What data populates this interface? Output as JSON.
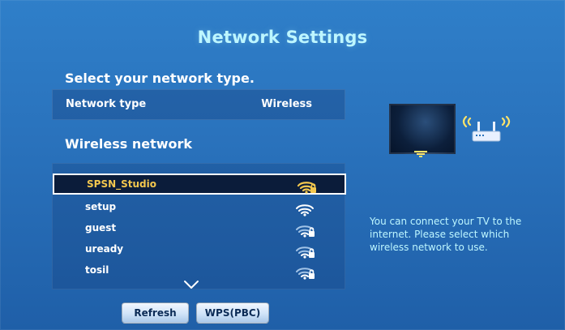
{
  "header": {
    "title": "Network Settings"
  },
  "labels": {
    "select_network_type": "Select your network type.",
    "network_type_key": "Network type",
    "network_type_value": "Wireless",
    "wireless_network": "Wireless network"
  },
  "networks": {
    "items": [
      {
        "name": "SPSN_Studio",
        "selected": true,
        "icon": "wifi-lock-strong-icon"
      },
      {
        "name": "setup",
        "selected": false,
        "icon": "wifi-open-icon"
      },
      {
        "name": "guest",
        "selected": false,
        "icon": "wifi-lock-icon"
      },
      {
        "name": "uready",
        "selected": false,
        "icon": "wifi-lock-icon"
      },
      {
        "name": "tosil",
        "selected": false,
        "icon": "wifi-lock-icon"
      }
    ]
  },
  "buttons": {
    "refresh": "Refresh",
    "wps": "WPS(PBC)"
  },
  "help": {
    "text": "You can connect your TV to the internet. Please select which wireless network to use."
  },
  "colors": {
    "background": "#2a73bd",
    "title": "#bdf6ff",
    "selected_text": "#f3c74e",
    "selected_bg": "#0b1c3a"
  }
}
